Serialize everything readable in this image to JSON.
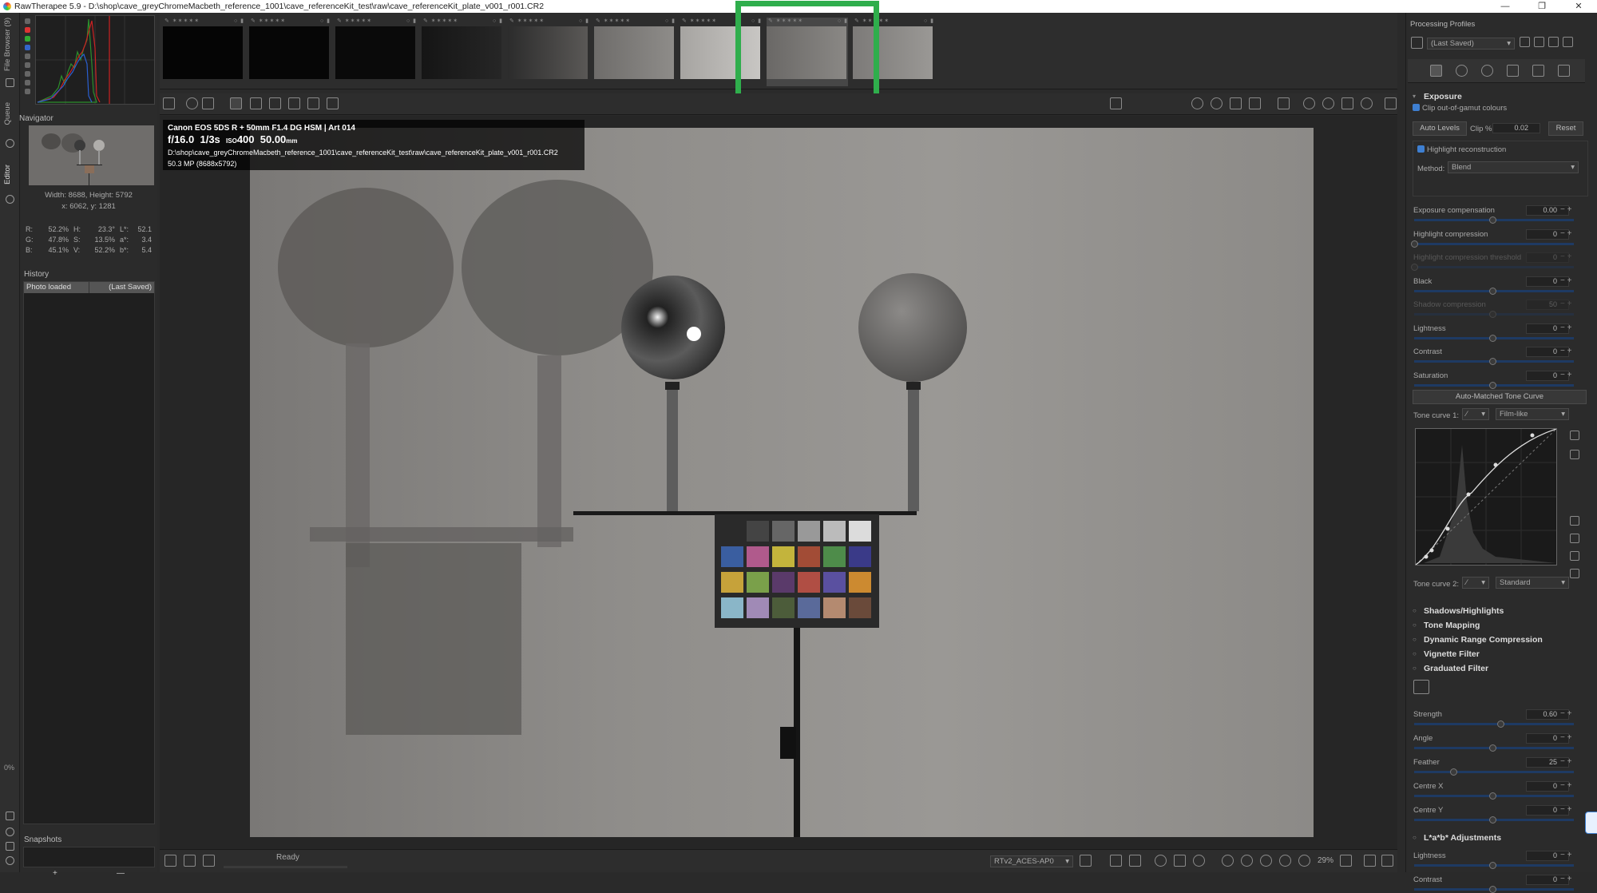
{
  "window": {
    "title": "RawTherapee 5.9 - D:\\shop\\cave_greyChromeMacbeth_reference_1001\\cave_referenceKit_test\\raw\\cave_referenceKit_plate_v001_r001.CR2",
    "minimize": "—",
    "maximize": "❐",
    "close": "✕"
  },
  "vertical_tabs": {
    "file_browser": "File Browser (9)",
    "queue": "Queue",
    "editor": "Editor"
  },
  "left_panel": {
    "navigator_title": "Navigator",
    "dimensions": "Width: 8688, Height: 5792",
    "coords": "x: 6062, y: 1281",
    "color_values": [
      {
        "a": "R:",
        "av": "52.2%",
        "b": "H:",
        "bv": "23.3°",
        "c": "L*:",
        "cv": "52.1"
      },
      {
        "a": "G:",
        "av": "47.8%",
        "b": "S:",
        "bv": "13.5%",
        "c": "a*:",
        "cv": "3.4"
      },
      {
        "a": "B:",
        "av": "45.1%",
        "b": "V:",
        "bv": "52.2%",
        "c": "b*:",
        "cv": "5.4"
      }
    ],
    "history_title": "History",
    "history_rows": [
      {
        "action": "Photo loaded",
        "value": "(Last Saved)"
      }
    ],
    "snapshots_title": "Snapshots",
    "snapshot_add": "+",
    "snapshot_remove": "—",
    "zoom_percent": "0%"
  },
  "exif": {
    "camera": "Canon EOS 5DS R + 50mm F1.4 DG HSM | Art 014",
    "aperture": "f/16.0",
    "shutter": "1/3s",
    "iso_label": "ISO",
    "iso": "400",
    "focal": "50.00",
    "focal_unit": "mm",
    "path": "D:\\shop\\cave_greyChromeMacbeth_reference_1001\\cave_referenceKit_test\\raw\\cave_referenceKit_plate_v001_r001.CR2",
    "megapixels": "50.3 MP (8688x5792)"
  },
  "status": {
    "text": "Ready",
    "profile": "RTv2_ACES-AP0",
    "zoom": "29%"
  },
  "right_panel": {
    "processing_profiles_title": "Processing Profiles",
    "profile_select": "(Last Saved)",
    "exposure_title": "Exposure",
    "clip_gamut": "Clip out-of-gamut colours",
    "auto_levels": "Auto Levels",
    "clip_label": "Clip %",
    "clip_value": "0.02",
    "reset": "Reset",
    "highlight_recon": "Highlight reconstruction",
    "method_label": "Method:",
    "method_value": "Blend",
    "sliders": [
      {
        "label": "Exposure compensation",
        "value": "0.00",
        "level": 0.5
      },
      {
        "label": "Highlight compression",
        "value": "0",
        "level": 0.0
      },
      {
        "label": "Highlight compression threshold",
        "value": "0",
        "level": 0.0,
        "disabled": true
      },
      {
        "label": "Black",
        "value": "0",
        "level": 0.5
      },
      {
        "label": "Shadow compression",
        "value": "50",
        "level": 0.5,
        "disabled": true
      },
      {
        "label": "Lightness",
        "value": "0",
        "level": 0.5
      },
      {
        "label": "Contrast",
        "value": "0",
        "level": 0.5
      },
      {
        "label": "Saturation",
        "value": "0",
        "level": 0.5
      }
    ],
    "auto_matched": "Auto-Matched Tone Curve",
    "tone_curve_1": "Tone curve 1:",
    "tone_curve_1_mode": "Film-like",
    "tone_curve_2": "Tone curve 2:",
    "tone_curve_2_mode": "Standard",
    "sections": [
      {
        "name": "Shadows/Highlights"
      },
      {
        "name": "Tone Mapping"
      },
      {
        "name": "Dynamic Range Compression"
      },
      {
        "name": "Vignette Filter"
      },
      {
        "name": "Graduated Filter"
      }
    ],
    "grad_sliders": [
      {
        "label": "Strength",
        "value": "0.60",
        "level": 0.55
      },
      {
        "label": "Angle",
        "value": "0",
        "level": 0.5
      },
      {
        "label": "Feather",
        "value": "25",
        "level": 0.25
      },
      {
        "label": "Centre X",
        "value": "0",
        "level": 0.5
      },
      {
        "label": "Centre Y",
        "value": "0",
        "level": 0.5
      }
    ],
    "lab_title": "L*a*b* Adjustments",
    "lab_sliders": [
      {
        "label": "Lightness",
        "value": "0",
        "level": 0.5
      },
      {
        "label": "Contrast",
        "value": "0",
        "level": 0.5
      }
    ]
  },
  "colors": {
    "accent": "#3e7fd1",
    "highlight_box": "#2fae4c"
  }
}
